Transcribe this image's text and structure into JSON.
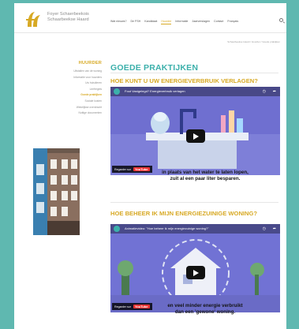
{
  "header": {
    "brand_line1": "Foyer Schaerbeekois",
    "brand_line2": "Schaarbeekse Haard",
    "nav": [
      "Wat nieuws?",
      "De FSH",
      "Kandidaat",
      "Huurder",
      "Informatie",
      "Jaarverslagen",
      "Contact",
      "Français"
    ],
    "active_nav": "Huurder"
  },
  "breadcrumb": "Schaarbeekse Haard / Huurder / Goede praktijken",
  "sidebar": {
    "title": "HUURDER",
    "items": [
      "Uitstallen van de woning",
      "Informatie voor huurders",
      "Uw huisdieren",
      "Leefregels",
      "Goede praktijken",
      "Sociale kosten",
      "Wekelijkse overdracht",
      "Nuttige documenten"
    ],
    "active_index": 4
  },
  "main": {
    "title": "GOEDE PRAKTIJKEN",
    "section1": {
      "title": "HOE KUNT U UW ENERGIEVERBRUIK VERLAGEN?",
      "video_title": "Fout Vastgelegd? Energieverbruik verlagen",
      "caption_line1": "in plaats van het water te laten lopen,",
      "caption_line2": "zuit al een paar liter besparen.",
      "watch_label": "Regarder sur",
      "yt_label": "YouTube"
    },
    "section2": {
      "title": "HOE BEHEER IK MIJN ENERGIEZUINIGE WONING?",
      "video_title": "Animatievideo: \"Hoe beheer ik mijn energiezuinige woning?\"",
      "caption_line1": "en veel minder energie verbruikt",
      "caption_line2": "dan een 'gewone' woning.",
      "watch_label": "Regarder sur",
      "yt_label": "YouTube"
    }
  },
  "colors": {
    "background": "#5fb8b0",
    "accent_gold": "#d7a924",
    "accent_teal": "#3cb0ab",
    "video_bg": "#6f6fd0"
  }
}
